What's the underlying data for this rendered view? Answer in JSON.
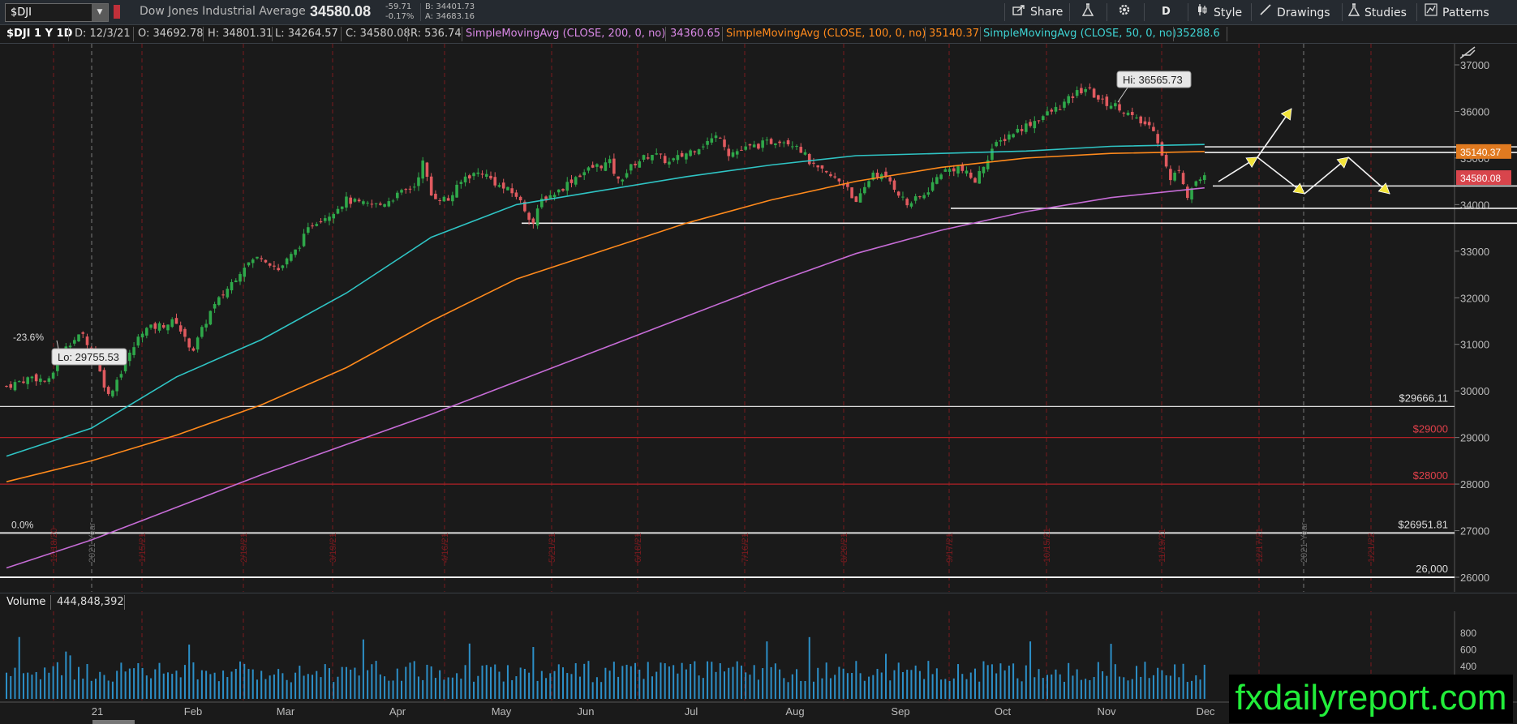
{
  "colors": {
    "sma200": "#c66cd6",
    "sma100": "#ff8a1c",
    "sma50": "#2fc4c4",
    "up": "#2fa84a",
    "down": "#e05a5f",
    "grid": "#2b2b2b",
    "redline": "#b02026",
    "watermark": "#22ee3a"
  },
  "topbar": {
    "symbol": "$DJI",
    "title": "Dow Jones Industrial Average",
    "last": "34580.08",
    "change": "-59.71",
    "change_pct": "-0.17%",
    "bid": "B: 34401.73",
    "ask": "A: 34683.16",
    "share": "Share",
    "period": "D",
    "style": "Style",
    "drawings": "Drawings",
    "studies": "Studies",
    "patterns": "Patterns"
  },
  "infobar": {
    "symbol_period": "$DJI 1 Y 1D",
    "date": "D: 12/3/21",
    "open": "O: 34692.78",
    "high": "H: 34801.31",
    "low": "L: 34264.57",
    "close": "C: 34580.08",
    "range": "R: 536.74",
    "sma200_label": "SimpleMovingAvg (CLOSE, 200, 0, no)",
    "sma200_val": "34360.65",
    "sma100_label": "SimpleMovingAvg (CLOSE, 100, 0, no)",
    "sma100_val": "35140.37",
    "sma50_label": "SimpleMovingAvg (CLOSE, 50, 0, no)",
    "sma50_val": "35288.6"
  },
  "volume": {
    "label": "Volume",
    "value": "444,848,392"
  },
  "chart_annotations": {
    "hi_label": "Hi: 36565.73",
    "lo_label": "Lo: 29755.53",
    "fib_23": "-23.6%",
    "fib_0": "0.0%",
    "lvl_29666": "$29666.11",
    "lvl_29000": "$29000",
    "lvl_28000": "$28000",
    "lvl_26951": "$26951.81",
    "lvl_26000": "26,000",
    "price_sma100_tag": "35140.37",
    "price_last_tag": "34580.08",
    "year_2021": "2021 Year",
    "year_2022": "2021 Year"
  },
  "watermark": "fxdailyreport.com",
  "chart_data": {
    "type": "candlestick",
    "ylim": [
      25850,
      37500
    ],
    "yticks": [
      26000,
      27000,
      28000,
      29000,
      30000,
      31000,
      32000,
      33000,
      34000,
      35000,
      36000,
      37000
    ],
    "xlabels": [
      "21",
      "Feb",
      "Mar",
      "Apr",
      "May",
      "Jun",
      "Jul",
      "Aug",
      "Sep",
      "Oct",
      "Nov",
      "Dec"
    ],
    "date_markers": [
      "12/18/20",
      "1/15/21",
      "2/19/21",
      "3/19/21",
      "4/16/21",
      "5/21/21",
      "6/18/21",
      "7/16/21",
      "8/20/21",
      "9/17/21",
      "10/15/21",
      "11/19/21",
      "12/17/21",
      "1/21/22"
    ],
    "price_path": [
      [
        0,
        30100
      ],
      [
        6,
        30300
      ],
      [
        10,
        30200
      ],
      [
        14,
        31000
      ],
      [
        18,
        31200
      ],
      [
        20,
        30900
      ],
      [
        24,
        29900
      ],
      [
        28,
        30600
      ],
      [
        32,
        31300
      ],
      [
        36,
        31400
      ],
      [
        40,
        31500
      ],
      [
        42,
        31100
      ],
      [
        44,
        30900
      ],
      [
        48,
        31700
      ],
      [
        52,
        32200
      ],
      [
        56,
        32700
      ],
      [
        60,
        32900
      ],
      [
        64,
        32600
      ],
      [
        68,
        33000
      ],
      [
        72,
        33600
      ],
      [
        76,
        33800
      ],
      [
        80,
        34100
      ],
      [
        84,
        34000
      ],
      [
        88,
        34000
      ],
      [
        92,
        34200
      ],
      [
        96,
        34400
      ],
      [
        98,
        34900
      ],
      [
        100,
        34200
      ],
      [
        104,
        34100
      ],
      [
        108,
        34600
      ],
      [
        112,
        34700
      ],
      [
        116,
        34400
      ],
      [
        120,
        34200
      ],
      [
        124,
        33600
      ],
      [
        126,
        34100
      ],
      [
        130,
        34300
      ],
      [
        134,
        34600
      ],
      [
        138,
        34800
      ],
      [
        142,
        34900
      ],
      [
        144,
        34500
      ],
      [
        148,
        34900
      ],
      [
        152,
        35100
      ],
      [
        156,
        34900
      ],
      [
        160,
        35100
      ],
      [
        164,
        35300
      ],
      [
        168,
        35500
      ],
      [
        170,
        35100
      ],
      [
        174,
        35200
      ],
      [
        178,
        35300
      ],
      [
        182,
        35400
      ],
      [
        186,
        35300
      ],
      [
        190,
        34800
      ],
      [
        194,
        34600
      ],
      [
        198,
        34400
      ],
      [
        200,
        34000
      ],
      [
        204,
        34700
      ],
      [
        208,
        34500
      ],
      [
        212,
        34000
      ],
      [
        216,
        34200
      ],
      [
        220,
        34700
      ],
      [
        224,
        34800
      ],
      [
        228,
        34500
      ],
      [
        232,
        35200
      ],
      [
        236,
        35500
      ],
      [
        240,
        35700
      ],
      [
        244,
        35900
      ],
      [
        248,
        36100
      ],
      [
        252,
        36400
      ],
      [
        254,
        36500
      ],
      [
        258,
        36200
      ],
      [
        262,
        36100
      ],
      [
        266,
        35800
      ],
      [
        270,
        35650
      ],
      [
        272,
        35100
      ],
      [
        274,
        34500
      ],
      [
        276,
        34800
      ],
      [
        278,
        34200
      ],
      [
        280,
        34500
      ],
      [
        282,
        34580
      ]
    ],
    "sma50_path": [
      [
        0,
        28600
      ],
      [
        20,
        29200
      ],
      [
        40,
        30300
      ],
      [
        60,
        31100
      ],
      [
        80,
        32100
      ],
      [
        100,
        33300
      ],
      [
        120,
        34000
      ],
      [
        140,
        34300
      ],
      [
        160,
        34600
      ],
      [
        180,
        34850
      ],
      [
        200,
        35050
      ],
      [
        220,
        35100
      ],
      [
        240,
        35150
      ],
      [
        260,
        35250
      ],
      [
        282,
        35290
      ]
    ],
    "sma100_path": [
      [
        0,
        28050
      ],
      [
        20,
        28500
      ],
      [
        40,
        29050
      ],
      [
        60,
        29700
      ],
      [
        80,
        30500
      ],
      [
        100,
        31500
      ],
      [
        120,
        32400
      ],
      [
        140,
        33000
      ],
      [
        160,
        33600
      ],
      [
        180,
        34100
      ],
      [
        200,
        34500
      ],
      [
        220,
        34800
      ],
      [
        240,
        35000
      ],
      [
        260,
        35100
      ],
      [
        282,
        35140
      ]
    ],
    "sma200_path": [
      [
        0,
        26200
      ],
      [
        20,
        26800
      ],
      [
        40,
        27500
      ],
      [
        60,
        28200
      ],
      [
        80,
        28850
      ],
      [
        100,
        29500
      ],
      [
        120,
        30200
      ],
      [
        140,
        30900
      ],
      [
        160,
        31600
      ],
      [
        180,
        32300
      ],
      [
        200,
        32950
      ],
      [
        220,
        33450
      ],
      [
        240,
        33850
      ],
      [
        260,
        34150
      ],
      [
        282,
        34360
      ]
    ],
    "volume_max": 800,
    "volume_ticks": [
      400,
      600,
      800
    ],
    "volume_unit": "millions>"
  }
}
